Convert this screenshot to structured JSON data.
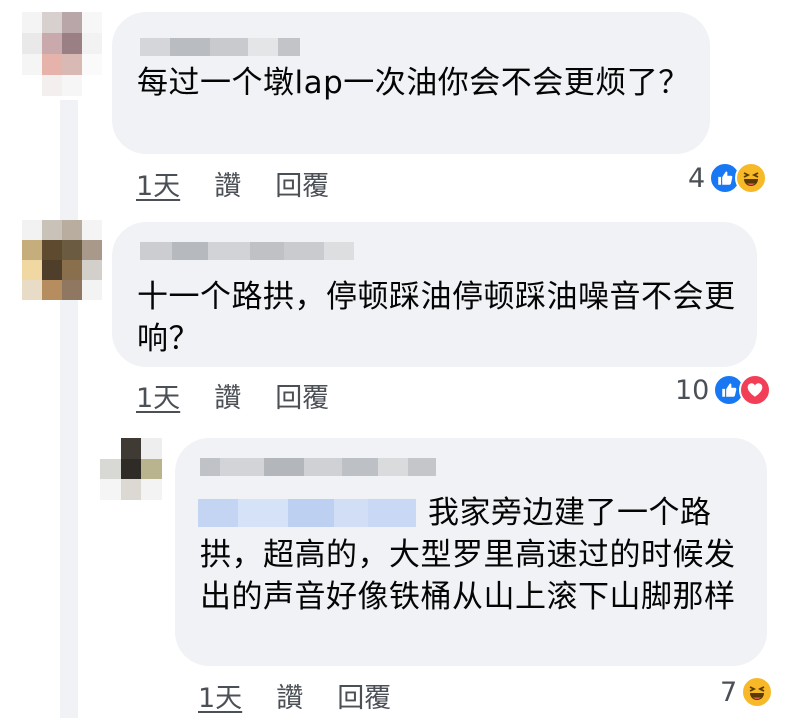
{
  "comments": [
    {
      "text": "每过一个墩lap一次油你会不会更烦了？",
      "time": "1天",
      "like_label": "讚",
      "reply_label": "回覆",
      "reaction_count": "4",
      "reactions": [
        "like",
        "haha"
      ]
    },
    {
      "text": "十一个路拱，停顿踩油停顿踩油噪音不会更响？",
      "time": "1天",
      "like_label": "讚",
      "reply_label": "回覆",
      "reaction_count": "10",
      "reactions": [
        "like",
        "love"
      ]
    },
    {
      "text": "我家旁边建了一个路拱，超高的，大型罗里高速过的时候发出的声音好像铁桶从山上滚下山脚那样",
      "time": "1天",
      "like_label": "讚",
      "reply_label": "回覆",
      "reaction_count": "7",
      "reactions": [
        "haha"
      ]
    }
  ],
  "colors": {
    "bubble": "#f0f2f5",
    "like_blue": "#1877f2",
    "love_red": "#f33e58",
    "haha_yellow": "#f7b928",
    "meta_text": "#4b4f56"
  }
}
